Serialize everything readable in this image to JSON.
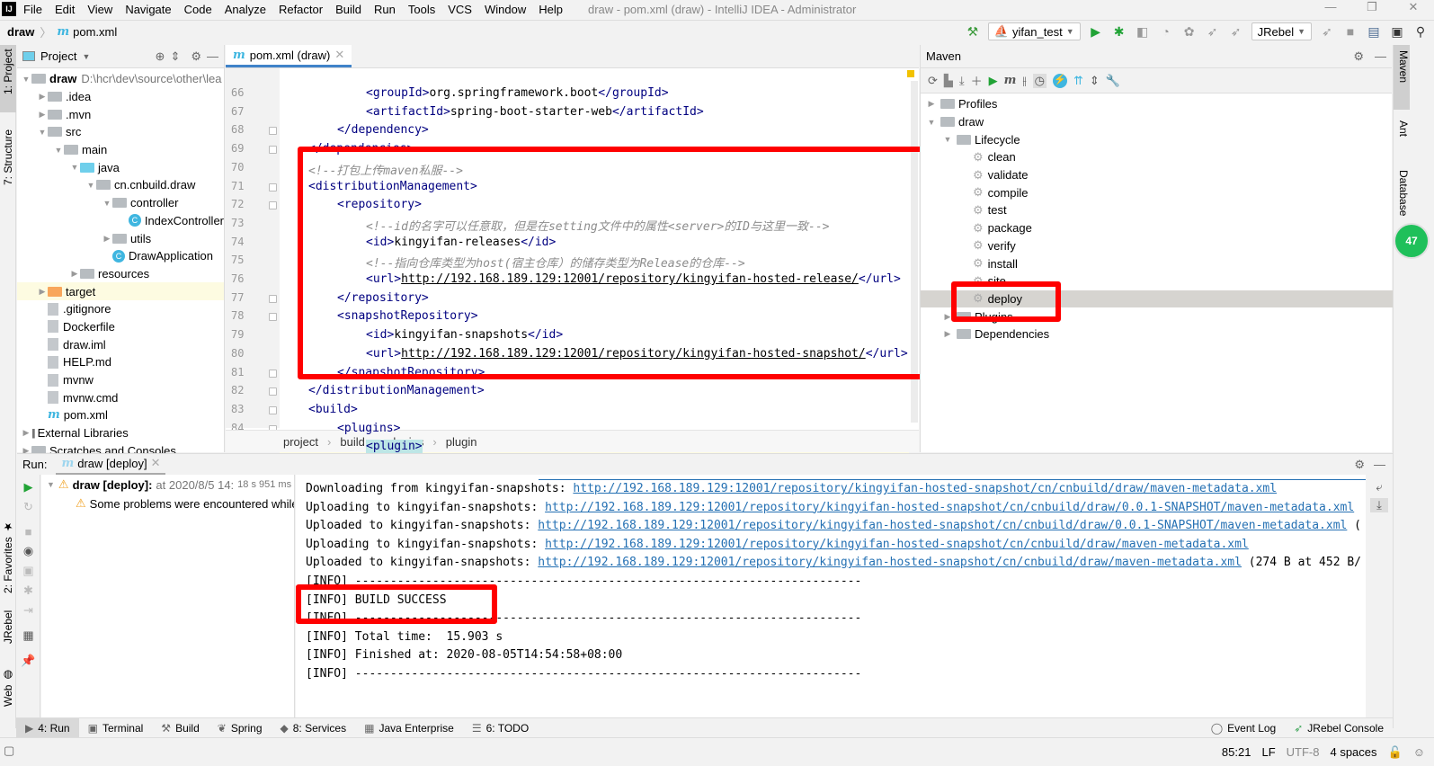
{
  "app": {
    "logo": "IJ",
    "window_title": "draw - pom.xml (draw) - IntelliJ IDEA - Administrator",
    "menu": [
      "File",
      "Edit",
      "View",
      "Navigate",
      "Code",
      "Analyze",
      "Refactor",
      "Build",
      "Run",
      "Tools",
      "VCS",
      "Window",
      "Help"
    ],
    "window_controls": [
      "—",
      "❐",
      "✕"
    ]
  },
  "navbar": {
    "project": "draw",
    "file": "pom.xml",
    "run_config": "yifan_test",
    "jrebel_combo": "JRebel"
  },
  "left_strip": {
    "tabs": [
      "1: Project",
      "7: Structure"
    ],
    "bottom_tabs": [
      "2: Favorites",
      "JRebel",
      "Web"
    ]
  },
  "project_panel": {
    "title": "Project",
    "tree": [
      {
        "label": "draw",
        "extra": "D:\\hcr\\dev\\source\\other\\lea",
        "depth": 0,
        "arrow": "▼",
        "type": "module",
        "bold": true
      },
      {
        "label": ".idea",
        "depth": 1,
        "arrow": "▶",
        "type": "folder"
      },
      {
        "label": ".mvn",
        "depth": 1,
        "arrow": "▶",
        "type": "folder"
      },
      {
        "label": "src",
        "depth": 1,
        "arrow": "▼",
        "type": "folder"
      },
      {
        "label": "main",
        "depth": 2,
        "arrow": "▼",
        "type": "folder"
      },
      {
        "label": "java",
        "depth": 3,
        "arrow": "▼",
        "type": "folder-blue"
      },
      {
        "label": "cn.cnbuild.draw",
        "depth": 4,
        "arrow": "▼",
        "type": "package"
      },
      {
        "label": "controller",
        "depth": 5,
        "arrow": "▼",
        "type": "package"
      },
      {
        "label": "IndexController",
        "depth": 6,
        "arrow": "",
        "type": "class"
      },
      {
        "label": "utils",
        "depth": 5,
        "arrow": "▶",
        "type": "package"
      },
      {
        "label": "DrawApplication",
        "depth": 5,
        "arrow": "",
        "type": "app-class"
      },
      {
        "label": "resources",
        "depth": 3,
        "arrow": "▶",
        "type": "folder"
      },
      {
        "label": "target",
        "depth": 1,
        "arrow": "▶",
        "type": "folder-orange",
        "highlight": true
      },
      {
        "label": ".gitignore",
        "depth": 1,
        "arrow": "",
        "type": "file"
      },
      {
        "label": "Dockerfile",
        "depth": 1,
        "arrow": "",
        "type": "file"
      },
      {
        "label": "draw.iml",
        "depth": 1,
        "arrow": "",
        "type": "file"
      },
      {
        "label": "HELP.md",
        "depth": 1,
        "arrow": "",
        "type": "file"
      },
      {
        "label": "mvnw",
        "depth": 1,
        "arrow": "",
        "type": "file"
      },
      {
        "label": "mvnw.cmd",
        "depth": 1,
        "arrow": "",
        "type": "file"
      },
      {
        "label": "pom.xml",
        "depth": 1,
        "arrow": "",
        "type": "maven"
      },
      {
        "label": "External Libraries",
        "depth": 0,
        "arrow": "▶",
        "type": "lib"
      },
      {
        "label": "Scratches and Consoles",
        "depth": 0,
        "arrow": "▶",
        "type": "scratch"
      }
    ]
  },
  "editor": {
    "tab": "pom.xml (draw)",
    "lines": [
      {
        "n": "66",
        "indent": 3,
        "html": "<span class='tag'>&lt;groupId&gt;</span>org.springframework.boot<span class='tag'>&lt;/groupId&gt;</span>"
      },
      {
        "n": "67",
        "indent": 3,
        "html": "<span class='tag'>&lt;artifactId&gt;</span>spring-boot-starter-web<span class='tag'>&lt;/artifactId&gt;</span>"
      },
      {
        "n": "68",
        "indent": 2,
        "html": "<span class='tag'>&lt;/dependency&gt;</span>"
      },
      {
        "n": "69",
        "indent": 1,
        "html": "<span class='tag'>&lt;/dependencies&gt;</span>"
      },
      {
        "n": "70",
        "indent": 1,
        "html": "<span class='cm'>&lt;!--打包上传maven私服--&gt;</span>"
      },
      {
        "n": "71",
        "indent": 1,
        "html": "<span class='tag'>&lt;distributionManagement&gt;</span>"
      },
      {
        "n": "72",
        "indent": 2,
        "html": "<span class='tag'>&lt;repository&gt;</span>"
      },
      {
        "n": "73",
        "indent": 3,
        "html": "<span class='cm'>&lt;!--id的名字可以任意取，但是在setting文件中的属性&lt;server&gt;的ID与这里一致--&gt;</span>"
      },
      {
        "n": "74",
        "indent": 3,
        "html": "<span class='tag'>&lt;id&gt;</span>kingyifan-releases<span class='tag'>&lt;/id&gt;</span>"
      },
      {
        "n": "75",
        "indent": 3,
        "html": "<span class='cm'>&lt;!--指向仓库类型为host(宿主仓库）的储存类型为Release的仓库--&gt;</span>"
      },
      {
        "n": "76",
        "indent": 3,
        "html": "<span class='tag'>&lt;url&gt;</span><span class='url'>http://192.168.189.129:12001/repository/kingyifan-hosted-release/</span><span class='tag'>&lt;/url&gt;</span>"
      },
      {
        "n": "77",
        "indent": 2,
        "html": "<span class='tag'>&lt;/repository&gt;</span>"
      },
      {
        "n": "78",
        "indent": 2,
        "html": "<span class='tag'>&lt;snapshotRepository&gt;</span>"
      },
      {
        "n": "79",
        "indent": 3,
        "html": "<span class='tag'>&lt;id&gt;</span>kingyifan-snapshots<span class='tag'>&lt;/id&gt;</span>"
      },
      {
        "n": "80",
        "indent": 3,
        "html": "<span class='tag'>&lt;url&gt;</span><span class='url'>http://192.168.189.129:12001/repository/kingyifan-hosted-snapshot/</span><span class='tag'>&lt;/url&gt;</span>"
      },
      {
        "n": "81",
        "indent": 2,
        "html": "<span class='tag'>&lt;/snapshotRepository&gt;</span>"
      },
      {
        "n": "82",
        "indent": 1,
        "html": "<span class='tag'>&lt;/distributionManagement&gt;</span>"
      },
      {
        "n": "83",
        "indent": 1,
        "html": "<span class='tag'>&lt;build&gt;</span>"
      },
      {
        "n": "84",
        "indent": 2,
        "html": "<span class='tag'>&lt;plugins&gt;</span>"
      },
      {
        "n": "85",
        "indent": 3,
        "html": "<span class='tag' style='background:#bde6e6'>&lt;plugin&gt;</span>"
      }
    ],
    "breadcrumb": [
      "project",
      "build",
      "plugins",
      "plugin"
    ]
  },
  "maven_panel": {
    "title": "Maven",
    "tree": [
      {
        "label": "Profiles",
        "depth": 0,
        "arrow": "▶",
        "type": "folder"
      },
      {
        "label": "draw",
        "depth": 0,
        "arrow": "▼",
        "type": "module"
      },
      {
        "label": "Lifecycle",
        "depth": 1,
        "arrow": "▼",
        "type": "folder"
      },
      {
        "label": "clean",
        "depth": 2,
        "type": "goal"
      },
      {
        "label": "validate",
        "depth": 2,
        "type": "goal"
      },
      {
        "label": "compile",
        "depth": 2,
        "type": "goal"
      },
      {
        "label": "test",
        "depth": 2,
        "type": "goal"
      },
      {
        "label": "package",
        "depth": 2,
        "type": "goal"
      },
      {
        "label": "verify",
        "depth": 2,
        "type": "goal"
      },
      {
        "label": "install",
        "depth": 2,
        "type": "goal"
      },
      {
        "label": "site",
        "depth": 2,
        "type": "goal"
      },
      {
        "label": "deploy",
        "depth": 2,
        "type": "goal",
        "selected": true
      },
      {
        "label": "Plugins",
        "depth": 1,
        "arrow": "▶",
        "type": "folder"
      },
      {
        "label": "Dependencies",
        "depth": 1,
        "arrow": "▶",
        "type": "folder"
      }
    ]
  },
  "right_strip": {
    "tabs": [
      "Maven",
      "Ant",
      "Database"
    ],
    "badge": "47"
  },
  "run_panel": {
    "label": "Run:",
    "tab": "draw [deploy]",
    "tree": {
      "root_label": "draw [deploy]:",
      "root_detail": "at 2020/8/5 14:",
      "duration": "18 s 951 ms",
      "child": "Some problems were encountered while"
    },
    "console": [
      {
        "prefix": "Downloading from kingyifan-snapshots: ",
        "url": "http://192.168.189.129:12001/repository/kingyifan-hosted-snapshot/cn/cnbuild/draw/maven-metadata.xml",
        "suffix": ""
      },
      {
        "prefix": "Uploading to kingyifan-snapshots: ",
        "url": "http://192.168.189.129:12001/repository/kingyifan-hosted-snapshot/cn/cnbuild/draw/0.0.1-SNAPSHOT/maven-metadata.xml",
        "suffix": ""
      },
      {
        "prefix": "Uploaded to kingyifan-snapshots: ",
        "url": "http://192.168.189.129:12001/repository/kingyifan-hosted-snapshot/cn/cnbuild/draw/0.0.1-SNAPSHOT/maven-metadata.xml",
        "suffix": " ("
      },
      {
        "prefix": "Uploading to kingyifan-snapshots: ",
        "url": "http://192.168.189.129:12001/repository/kingyifan-hosted-snapshot/cn/cnbuild/draw/maven-metadata.xml",
        "suffix": ""
      },
      {
        "prefix": "Uploaded to kingyifan-snapshots: ",
        "url": "http://192.168.189.129:12001/repository/kingyifan-hosted-snapshot/cn/cnbuild/draw/maven-metadata.xml",
        "suffix": " (274 B at 452 B/"
      },
      {
        "prefix": "[INFO] ------------------------------------------------------------------------",
        "url": "",
        "suffix": ""
      },
      {
        "prefix": "[INFO] BUILD SUCCESS",
        "url": "",
        "suffix": ""
      },
      {
        "prefix": "[INFO] ------------------------------------------------------------------------",
        "url": "",
        "suffix": ""
      },
      {
        "prefix": "[INFO] Total time:  15.903 s",
        "url": "",
        "suffix": ""
      },
      {
        "prefix": "[INFO] Finished at: 2020-08-05T14:54:58+08:00",
        "url": "",
        "suffix": ""
      },
      {
        "prefix": "[INFO] ------------------------------------------------------------------------",
        "url": "",
        "suffix": ""
      }
    ]
  },
  "bottom_tabs": [
    {
      "label": "4: Run",
      "icon": "▶",
      "active": true
    },
    {
      "label": "Terminal",
      "icon": "▣"
    },
    {
      "label": "Build",
      "icon": "⚒"
    },
    {
      "label": "Spring",
      "icon": "❦"
    },
    {
      "label": "8: Services",
      "icon": "◆"
    },
    {
      "label": "Java Enterprise",
      "icon": "▦"
    },
    {
      "label": "6: TODO",
      "icon": "☰"
    }
  ],
  "bottom_right_tabs": [
    {
      "label": "Event Log",
      "icon": "◯"
    },
    {
      "label": "JRebel Console",
      "icon": "➶"
    }
  ],
  "status": {
    "position": "85:21",
    "line_sep": "LF",
    "encoding": "UTF-8",
    "indent": "4 spaces"
  },
  "colors": {
    "accent": "#4083c9",
    "highlight_box": "#ff0000",
    "link": "#2470b3",
    "run_green": "#21a336"
  }
}
